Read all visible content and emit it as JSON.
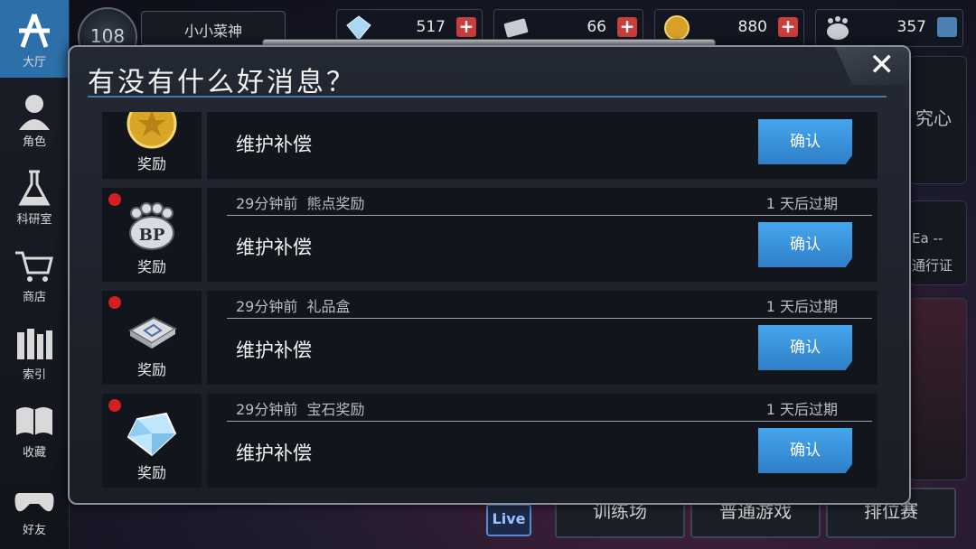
{
  "sidebar": {
    "items": [
      {
        "label": "大厅",
        "icon": "lobby-star-icon",
        "active": true
      },
      {
        "label": "角色",
        "icon": "character-icon"
      },
      {
        "label": "科研室",
        "icon": "flask-icon"
      },
      {
        "label": "商店",
        "icon": "cart-icon"
      },
      {
        "label": "索引",
        "icon": "books-icon"
      },
      {
        "label": "收藏",
        "icon": "book-icon"
      },
      {
        "label": "好友",
        "icon": "gamepad-icon"
      }
    ]
  },
  "player": {
    "level": "108",
    "name": "小小菜神"
  },
  "resources": [
    {
      "icon": "gem-icon",
      "value": "517",
      "action": "add"
    },
    {
      "icon": "card-icon",
      "value": "66",
      "action": "add"
    },
    {
      "icon": "coin-icon",
      "value": "880",
      "action": "add"
    },
    {
      "icon": "bp-icon",
      "value": "357",
      "action": "exchange"
    }
  ],
  "background": {
    "side_text_1": "究心",
    "side_text_2": "Ea --",
    "side_text_3": "通行证",
    "bottom_buttons": [
      "训练场",
      "普通游戏",
      "排位赛"
    ],
    "live_label": "Live"
  },
  "modal": {
    "title": "有没有什么好消息？",
    "close_label": "✕",
    "messages": [
      {
        "icon": "gold-coin-icon",
        "reward_label": "奖励",
        "time": "",
        "type": "",
        "expire": "",
        "text": "维护补偿",
        "button": "确认",
        "unread": false
      },
      {
        "icon": "bp-paw-icon",
        "reward_label": "奖励",
        "time": "29分钟前",
        "type": "熊点奖励",
        "expire": "1 天后过期",
        "text": "维护补偿",
        "button": "确认",
        "unread": true
      },
      {
        "icon": "gift-box-icon",
        "reward_label": "奖励",
        "time": "29分钟前",
        "type": "礼品盒",
        "expire": "1 天后过期",
        "text": "维护补偿",
        "button": "确认",
        "unread": true
      },
      {
        "icon": "diamond-icon",
        "reward_label": "奖励",
        "time": "29分钟前",
        "type": "宝石奖励",
        "expire": "1 天后过期",
        "text": "维护补偿",
        "button": "确认",
        "unread": true
      }
    ]
  },
  "colors": {
    "accent": "#3a93dd",
    "unread_dot": "#d31f1f",
    "sidebar_active": "#2d6fa8",
    "title_line": "#4b77a4"
  }
}
